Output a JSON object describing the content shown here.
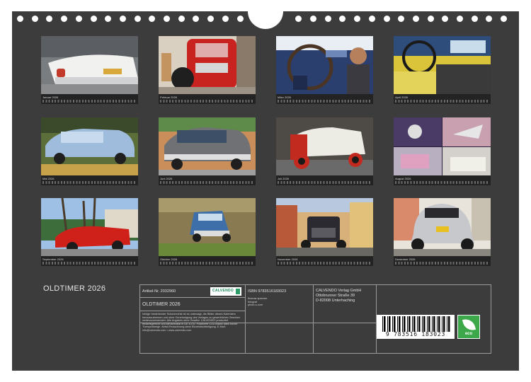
{
  "calendar": {
    "title": "OLDTIMER  2026",
    "months": [
      {
        "name": "Januar 2026",
        "subject": "white Plymouth tail fin"
      },
      {
        "name": "Februar 2026",
        "subject": "red vintage truck front"
      },
      {
        "name": "März 2026",
        "subject": "driver at steering wheel"
      },
      {
        "name": "April 2026",
        "subject": "yellow car interior"
      },
      {
        "name": "Mai 2026",
        "subject": "light blue sedan"
      },
      {
        "name": "Juni 2026",
        "subject": "grey Chevrolet rear"
      },
      {
        "name": "Juli 2026",
        "subject": "red and white vintage car"
      },
      {
        "name": "August 2026",
        "subject": "hood ornament collage"
      },
      {
        "name": "September 2026",
        "subject": "red convertible under palms"
      },
      {
        "name": "Oktober 2026",
        "subject": "blue car in dirt lot"
      },
      {
        "name": "November 2026",
        "subject": "black car on street"
      },
      {
        "name": "Dezember 2026",
        "subject": "silver VW Beetle rear"
      }
    ]
  },
  "info": {
    "article_no": "Artikel-Nr. 2032960",
    "product_title": "OLDTIMER  2026",
    "legal_text": "Infolge bestehender Schutzrechte ist es untersagt, die Bilder dieses Kalenders herauszutrennen und ohne Genehmigung des Verlages zu gewerblichen Zwecken weiterzuverwenden. Alle Angaben ohne Gewähr. CALVENDO produziert bedarfsgerecht und klimaneutral in DE & EU. Positivere CO2-Bilanz dank kurzer Transportwege. Abfall-Reduzierung dank Einzelstückfertigung. E-Mail: info@calvendo.com • www.calvendo.com",
    "isbn": "ISBN 9783516183023",
    "author_lines": [
      "thomas spanner",
      "fotograf",
      "photo-s.com"
    ],
    "publisher_lines": [
      "CALVENDO Verlag GmbH",
      "Ottobrunner Straße 39",
      "D-82008 Unterhaching"
    ],
    "calvendo_logo": "CALVENDO",
    "barcode_number": "9 783516 183023",
    "eco_label": "eco"
  },
  "colors": {
    "background": "#3c3c3c",
    "strip": "#232323",
    "eco_green": "#3ca84a"
  }
}
